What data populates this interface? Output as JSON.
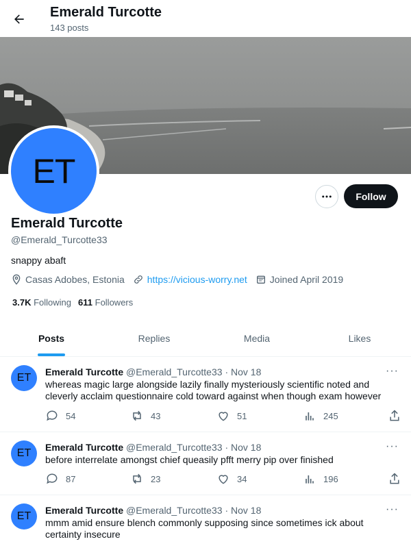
{
  "header": {
    "title": "Emerald Turcotte",
    "post_count": "143 posts"
  },
  "profile": {
    "avatar_initials": "ET",
    "name": "Emerald Turcotte",
    "handle": "@Emerald_Turcotte33",
    "bio": "snappy abaft",
    "location": "Casas Adobes, Estonia",
    "website": "https://vicious-worry.net",
    "joined": "Joined April 2019",
    "following_count": "3.7K",
    "following_label": "Following",
    "followers_count": "611",
    "followers_label": "Followers",
    "follow_label": "Follow",
    "more_label": "···"
  },
  "tabs": [
    {
      "label": "Posts",
      "active": true
    },
    {
      "label": "Replies",
      "active": false
    },
    {
      "label": "Media",
      "active": false
    },
    {
      "label": "Likes",
      "active": false
    }
  ],
  "posts": [
    {
      "avatar": "ET",
      "name": "Emerald Turcotte",
      "handle": "@Emerald_Turcotte33",
      "sep": "·",
      "date": "Nov 18",
      "more": "···",
      "text": "whereas magic large alongside lazily finally mysteriously scientific noted and cleverly acclaim questionnaire cold toward against when though exam however",
      "replies": "54",
      "reposts": "43",
      "likes": "51",
      "views": "245"
    },
    {
      "avatar": "ET",
      "name": "Emerald Turcotte",
      "handle": "@Emerald_Turcotte33",
      "sep": "·",
      "date": "Nov 18",
      "more": "···",
      "text": "before interrelate amongst chief queasily pfft merry pip over finished",
      "replies": "87",
      "reposts": "23",
      "likes": "34",
      "views": "196"
    },
    {
      "avatar": "ET",
      "name": "Emerald Turcotte",
      "handle": "@Emerald_Turcotte33",
      "sep": "·",
      "date": "Nov 18",
      "more": "···",
      "text": "mmm amid ensure blench commonly supposing since sometimes ick about certainty insecure"
    }
  ],
  "colors": {
    "accent": "#1d9bf0",
    "avatar": "#2f80ff",
    "follow_bg": "#0f1419",
    "muted": "#536471"
  }
}
